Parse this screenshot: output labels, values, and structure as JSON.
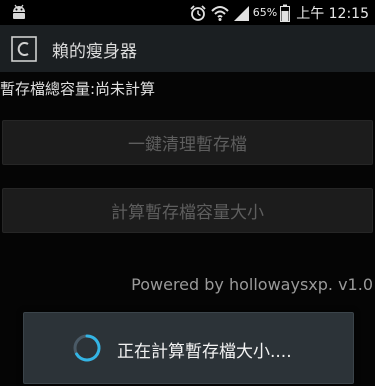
{
  "status_bar": {
    "icons": [
      "android-icon",
      "alarm-icon",
      "wifi-icon",
      "signal-icon",
      "battery-icon"
    ],
    "battery_percent": "65%",
    "time": "上午 12:15"
  },
  "action_bar": {
    "app_icon": "app-logo-icon",
    "title": "賴的瘦身器"
  },
  "main": {
    "cache_status": "暫存檔總容量:尚未計算",
    "clean_button_label": "一鍵清理暫存檔",
    "calc_button_label": "計算暫存檔容量大小",
    "powered_by": "Powered by hollowaysxp. v1.0"
  },
  "progress_dialog": {
    "spinner_icon": "spinner-icon",
    "message": "正在計算暫存檔大小...."
  },
  "colors": {
    "background": "#050505",
    "action_bar": "#1b1f22",
    "disabled_text": "#5e5e5e",
    "dialog": "#2c3338",
    "spinner_accent": "#33b5e5"
  }
}
